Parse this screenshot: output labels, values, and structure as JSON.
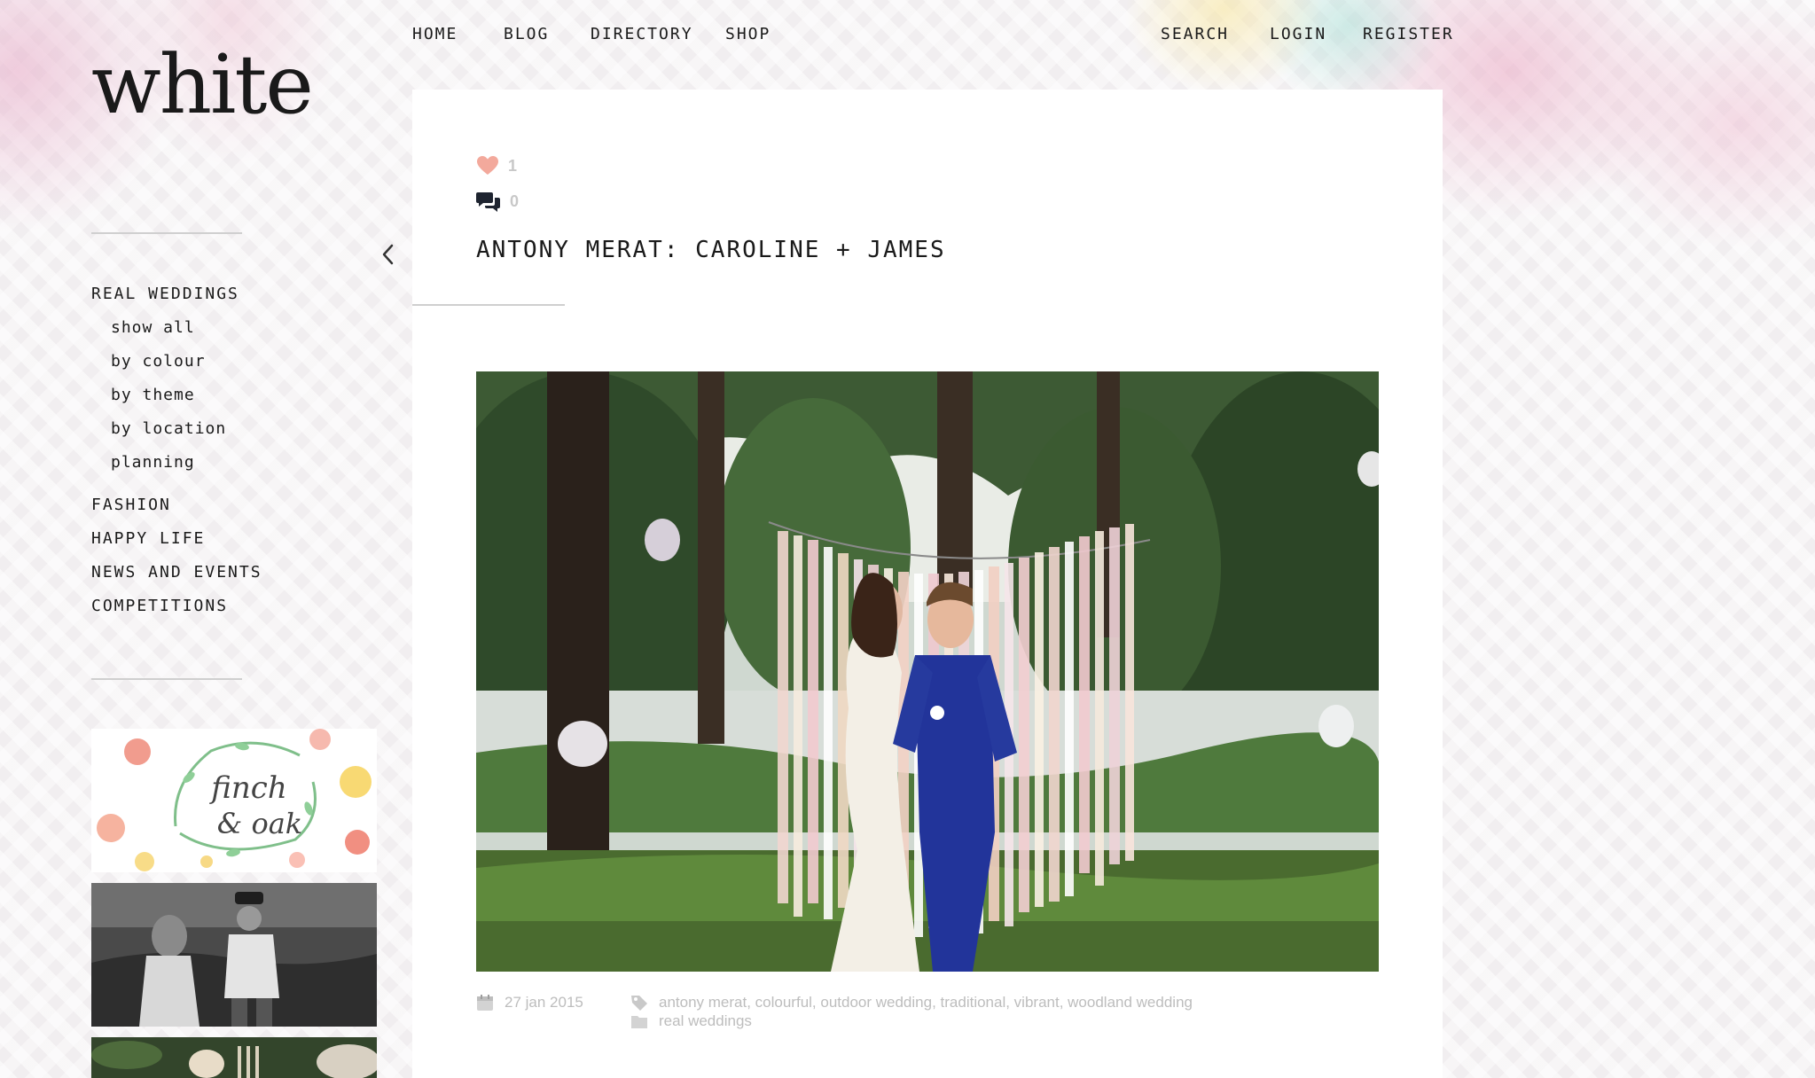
{
  "site": {
    "logo": "white"
  },
  "top_nav": {
    "home": "HOME",
    "blog": "BLOG",
    "directory": "DIRECTORY",
    "shop": "SHOP",
    "search": "SEARCH",
    "login": "LOGIN",
    "register": "REGISTER"
  },
  "sidebar": {
    "real_weddings": "REAL WEDDINGS",
    "sub": [
      "show all",
      "by colour",
      "by theme",
      "by location",
      "planning"
    ],
    "fashion": "FASHION",
    "happy_life": "HAPPY LIFE",
    "news_events": "NEWS AND EVENTS",
    "competitions": "COMPETITIONS",
    "thumb1_text_1": "finch",
    "thumb1_text_2": "& oak"
  },
  "post": {
    "likes": "1",
    "comments": "0",
    "title": "ANTONY MERAT: CAROLINE + JAMES",
    "date": "27 jan 2015",
    "tags": "antony merat, colourful, outdoor wedding, traditional, vibrant, woodland wedding",
    "category": "real weddings"
  },
  "colors": {
    "like_heart": "#f3a99c",
    "meta_grey": "#bdbdbd",
    "text": "#1a1a1a",
    "panel": "#ffffff"
  },
  "icons": {
    "like": "heart-icon",
    "comment": "comment-bubbles-icon",
    "back": "chevron-left-icon",
    "date": "calendar-icon",
    "tag": "tag-icon",
    "category": "folder-icon"
  }
}
